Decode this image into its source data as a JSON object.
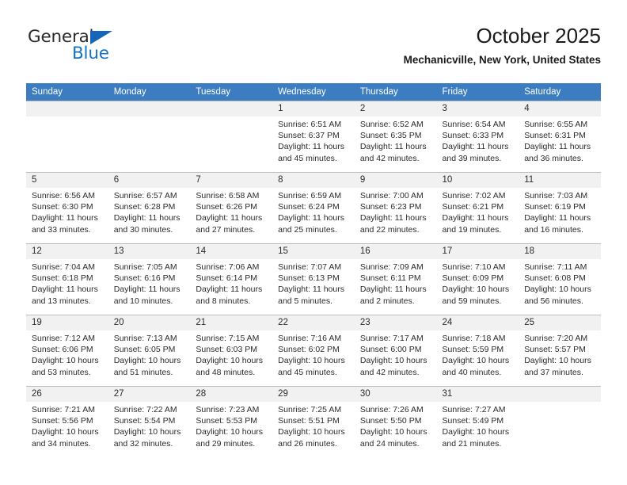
{
  "brand": {
    "name_part1": "General",
    "name_part2": "Blue",
    "triangle_color": "#1565b8",
    "blue_color": "#1473c4"
  },
  "header": {
    "title": "October 2025",
    "subtitle": "Mechanicville, New York, United States"
  },
  "theme": {
    "header_bg": "#3b7dc0",
    "daynum_bg": "#f1f1f1",
    "grid_line": "#bdbdbd"
  },
  "weekdays": [
    "Sunday",
    "Monday",
    "Tuesday",
    "Wednesday",
    "Thursday",
    "Friday",
    "Saturday"
  ],
  "weeks": [
    [
      {
        "empty": true
      },
      {
        "empty": true
      },
      {
        "empty": true
      },
      {
        "day": "1",
        "sunrise": "Sunrise: 6:51 AM",
        "sunset": "Sunset: 6:37 PM",
        "daylight1": "Daylight: 11 hours",
        "daylight2": "and 45 minutes."
      },
      {
        "day": "2",
        "sunrise": "Sunrise: 6:52 AM",
        "sunset": "Sunset: 6:35 PM",
        "daylight1": "Daylight: 11 hours",
        "daylight2": "and 42 minutes."
      },
      {
        "day": "3",
        "sunrise": "Sunrise: 6:54 AM",
        "sunset": "Sunset: 6:33 PM",
        "daylight1": "Daylight: 11 hours",
        "daylight2": "and 39 minutes."
      },
      {
        "day": "4",
        "sunrise": "Sunrise: 6:55 AM",
        "sunset": "Sunset: 6:31 PM",
        "daylight1": "Daylight: 11 hours",
        "daylight2": "and 36 minutes."
      }
    ],
    [
      {
        "day": "5",
        "sunrise": "Sunrise: 6:56 AM",
        "sunset": "Sunset: 6:30 PM",
        "daylight1": "Daylight: 11 hours",
        "daylight2": "and 33 minutes."
      },
      {
        "day": "6",
        "sunrise": "Sunrise: 6:57 AM",
        "sunset": "Sunset: 6:28 PM",
        "daylight1": "Daylight: 11 hours",
        "daylight2": "and 30 minutes."
      },
      {
        "day": "7",
        "sunrise": "Sunrise: 6:58 AM",
        "sunset": "Sunset: 6:26 PM",
        "daylight1": "Daylight: 11 hours",
        "daylight2": "and 27 minutes."
      },
      {
        "day": "8",
        "sunrise": "Sunrise: 6:59 AM",
        "sunset": "Sunset: 6:24 PM",
        "daylight1": "Daylight: 11 hours",
        "daylight2": "and 25 minutes."
      },
      {
        "day": "9",
        "sunrise": "Sunrise: 7:00 AM",
        "sunset": "Sunset: 6:23 PM",
        "daylight1": "Daylight: 11 hours",
        "daylight2": "and 22 minutes."
      },
      {
        "day": "10",
        "sunrise": "Sunrise: 7:02 AM",
        "sunset": "Sunset: 6:21 PM",
        "daylight1": "Daylight: 11 hours",
        "daylight2": "and 19 minutes."
      },
      {
        "day": "11",
        "sunrise": "Sunrise: 7:03 AM",
        "sunset": "Sunset: 6:19 PM",
        "daylight1": "Daylight: 11 hours",
        "daylight2": "and 16 minutes."
      }
    ],
    [
      {
        "day": "12",
        "sunrise": "Sunrise: 7:04 AM",
        "sunset": "Sunset: 6:18 PM",
        "daylight1": "Daylight: 11 hours",
        "daylight2": "and 13 minutes."
      },
      {
        "day": "13",
        "sunrise": "Sunrise: 7:05 AM",
        "sunset": "Sunset: 6:16 PM",
        "daylight1": "Daylight: 11 hours",
        "daylight2": "and 10 minutes."
      },
      {
        "day": "14",
        "sunrise": "Sunrise: 7:06 AM",
        "sunset": "Sunset: 6:14 PM",
        "daylight1": "Daylight: 11 hours",
        "daylight2": "and 8 minutes."
      },
      {
        "day": "15",
        "sunrise": "Sunrise: 7:07 AM",
        "sunset": "Sunset: 6:13 PM",
        "daylight1": "Daylight: 11 hours",
        "daylight2": "and 5 minutes."
      },
      {
        "day": "16",
        "sunrise": "Sunrise: 7:09 AM",
        "sunset": "Sunset: 6:11 PM",
        "daylight1": "Daylight: 11 hours",
        "daylight2": "and 2 minutes."
      },
      {
        "day": "17",
        "sunrise": "Sunrise: 7:10 AM",
        "sunset": "Sunset: 6:09 PM",
        "daylight1": "Daylight: 10 hours",
        "daylight2": "and 59 minutes."
      },
      {
        "day": "18",
        "sunrise": "Sunrise: 7:11 AM",
        "sunset": "Sunset: 6:08 PM",
        "daylight1": "Daylight: 10 hours",
        "daylight2": "and 56 minutes."
      }
    ],
    [
      {
        "day": "19",
        "sunrise": "Sunrise: 7:12 AM",
        "sunset": "Sunset: 6:06 PM",
        "daylight1": "Daylight: 10 hours",
        "daylight2": "and 53 minutes."
      },
      {
        "day": "20",
        "sunrise": "Sunrise: 7:13 AM",
        "sunset": "Sunset: 6:05 PM",
        "daylight1": "Daylight: 10 hours",
        "daylight2": "and 51 minutes."
      },
      {
        "day": "21",
        "sunrise": "Sunrise: 7:15 AM",
        "sunset": "Sunset: 6:03 PM",
        "daylight1": "Daylight: 10 hours",
        "daylight2": "and 48 minutes."
      },
      {
        "day": "22",
        "sunrise": "Sunrise: 7:16 AM",
        "sunset": "Sunset: 6:02 PM",
        "daylight1": "Daylight: 10 hours",
        "daylight2": "and 45 minutes."
      },
      {
        "day": "23",
        "sunrise": "Sunrise: 7:17 AM",
        "sunset": "Sunset: 6:00 PM",
        "daylight1": "Daylight: 10 hours",
        "daylight2": "and 42 minutes."
      },
      {
        "day": "24",
        "sunrise": "Sunrise: 7:18 AM",
        "sunset": "Sunset: 5:59 PM",
        "daylight1": "Daylight: 10 hours",
        "daylight2": "and 40 minutes."
      },
      {
        "day": "25",
        "sunrise": "Sunrise: 7:20 AM",
        "sunset": "Sunset: 5:57 PM",
        "daylight1": "Daylight: 10 hours",
        "daylight2": "and 37 minutes."
      }
    ],
    [
      {
        "day": "26",
        "sunrise": "Sunrise: 7:21 AM",
        "sunset": "Sunset: 5:56 PM",
        "daylight1": "Daylight: 10 hours",
        "daylight2": "and 34 minutes."
      },
      {
        "day": "27",
        "sunrise": "Sunrise: 7:22 AM",
        "sunset": "Sunset: 5:54 PM",
        "daylight1": "Daylight: 10 hours",
        "daylight2": "and 32 minutes."
      },
      {
        "day": "28",
        "sunrise": "Sunrise: 7:23 AM",
        "sunset": "Sunset: 5:53 PM",
        "daylight1": "Daylight: 10 hours",
        "daylight2": "and 29 minutes."
      },
      {
        "day": "29",
        "sunrise": "Sunrise: 7:25 AM",
        "sunset": "Sunset: 5:51 PM",
        "daylight1": "Daylight: 10 hours",
        "daylight2": "and 26 minutes."
      },
      {
        "day": "30",
        "sunrise": "Sunrise: 7:26 AM",
        "sunset": "Sunset: 5:50 PM",
        "daylight1": "Daylight: 10 hours",
        "daylight2": "and 24 minutes."
      },
      {
        "day": "31",
        "sunrise": "Sunrise: 7:27 AM",
        "sunset": "Sunset: 5:49 PM",
        "daylight1": "Daylight: 10 hours",
        "daylight2": "and 21 minutes."
      },
      {
        "empty": true
      }
    ]
  ]
}
